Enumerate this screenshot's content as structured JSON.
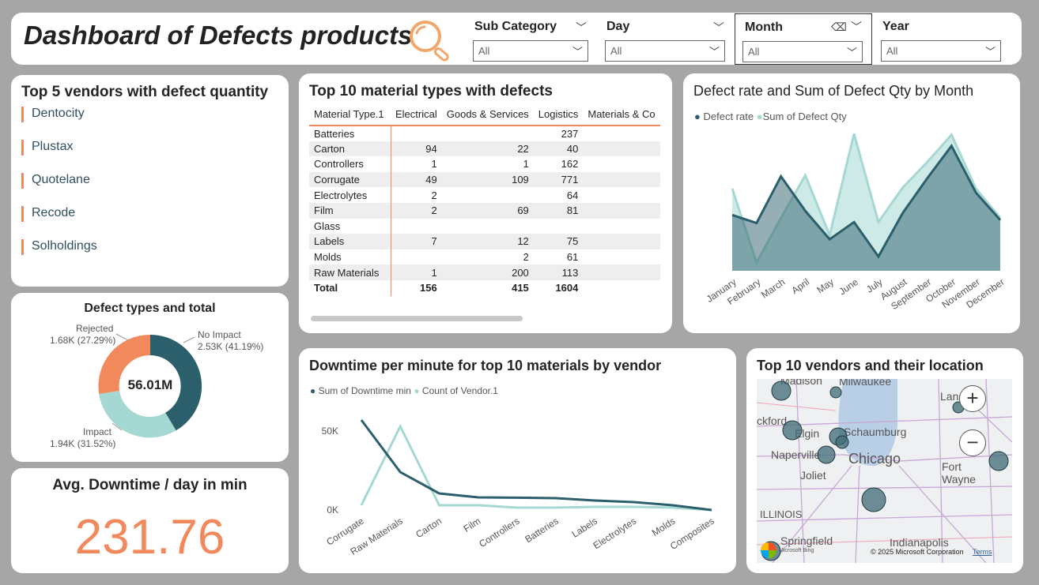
{
  "header": {
    "title": "Dashboard of Defects products",
    "icon": "magnifier-icon",
    "slicers": [
      {
        "label": "Sub Category",
        "value": "All"
      },
      {
        "label": "Day",
        "value": "All"
      },
      {
        "label": "Month",
        "value": "All"
      },
      {
        "label": "Year",
        "value": "All"
      }
    ]
  },
  "vendors": {
    "title": "Top 5 vendors with defect quantity",
    "items": [
      "Dentocity",
      "Plustax",
      "Quotelane",
      "Recode",
      "Solholdings"
    ]
  },
  "defect_types": {
    "title": "Defect types and total",
    "center": "56.01M",
    "labels": [
      {
        "name": "No Impact",
        "value": "2.53K (41.19%)"
      },
      {
        "name": "Impact",
        "value": "1.94K (31.52%)"
      },
      {
        "name": "Rejected",
        "value": "1.68K (27.29%)"
      }
    ]
  },
  "avg_downtime": {
    "title": "Avg. Downtime / day in min",
    "value": "231.76"
  },
  "materials": {
    "title": "Top 10 material types with defects",
    "columns": [
      "Material Type.1",
      "Electrical",
      "Goods & Services",
      "Logistics",
      "Materials & Co"
    ],
    "rows": [
      [
        "Batteries",
        "",
        "",
        "237",
        ""
      ],
      [
        "Carton",
        "94",
        "22",
        "40",
        ""
      ],
      [
        "Controllers",
        "1",
        "1",
        "162",
        ""
      ],
      [
        "Corrugate",
        "49",
        "109",
        "771",
        ""
      ],
      [
        "Electrolytes",
        "2",
        "",
        "64",
        ""
      ],
      [
        "Film",
        "2",
        "69",
        "81",
        ""
      ],
      [
        "Glass",
        "",
        "",
        "",
        ""
      ],
      [
        "Labels",
        "7",
        "12",
        "75",
        ""
      ],
      [
        "Molds",
        "",
        "2",
        "61",
        ""
      ],
      [
        "Raw Materials",
        "1",
        "200",
        "113",
        ""
      ]
    ],
    "total": [
      "Total",
      "156",
      "415",
      "1604",
      ""
    ]
  },
  "map": {
    "title": "Top 10 vendors and their location",
    "cities": [
      "Madison",
      "Milwaukee",
      "Lansing",
      "ckford",
      "Elgin",
      "Schaumburg",
      "Naperville",
      "Chicago",
      "Joliet",
      "Fort Wayne",
      "ILLINOIS",
      "Springfield",
      "Indianapolis"
    ],
    "copyright": "© 2025 Microsoft Corporation",
    "terms": "Terms",
    "bing": "Microsoft Bing",
    "colors": {
      "bubble": "#3f6b76"
    }
  },
  "chart_data": [
    {
      "type": "area",
      "title": "Defect rate and Sum of Defect Qty by Month",
      "categories": [
        "January",
        "February",
        "March",
        "April",
        "May",
        "June",
        "July",
        "August",
        "September",
        "October",
        "November",
        "December"
      ],
      "series": [
        {
          "name": "Defect rate",
          "color": "#2b5f6b",
          "values": [
            0.55,
            0.47,
            0.93,
            0.59,
            0.31,
            0.48,
            0.14,
            0.57,
            0.91,
            1.23,
            0.77,
            0.5
          ]
        },
        {
          "name": "Sum of Defect Qty",
          "color": "#a6d8d3",
          "values": [
            0.81,
            0.08,
            0.52,
            0.94,
            0.35,
            1.35,
            0.48,
            0.82,
            1.07,
            1.34,
            0.81,
            0.52
          ]
        }
      ]
    },
    {
      "type": "line",
      "title": "Downtime per minute for top 10 materials by vendor",
      "categories": [
        "Corrugate",
        "Raw Materials",
        "Carton",
        "Film",
        "Controllers",
        "Batteries",
        "Labels",
        "Electrolytes",
        "Molds",
        "Composites"
      ],
      "yticks": [
        "50K",
        "0K"
      ],
      "series": [
        {
          "name": "Sum of Downtime min",
          "color": "#2b5f6b",
          "values": [
            57000,
            24000,
            10500,
            8000,
            7800,
            7500,
            6000,
            5000,
            3000,
            0
          ]
        },
        {
          "name": "Count of Vendor.1",
          "color": "#a6d8d3",
          "values": [
            3000,
            53000,
            3000,
            3000,
            1500,
            1500,
            2000,
            2000,
            1500,
            0
          ]
        }
      ]
    }
  ]
}
